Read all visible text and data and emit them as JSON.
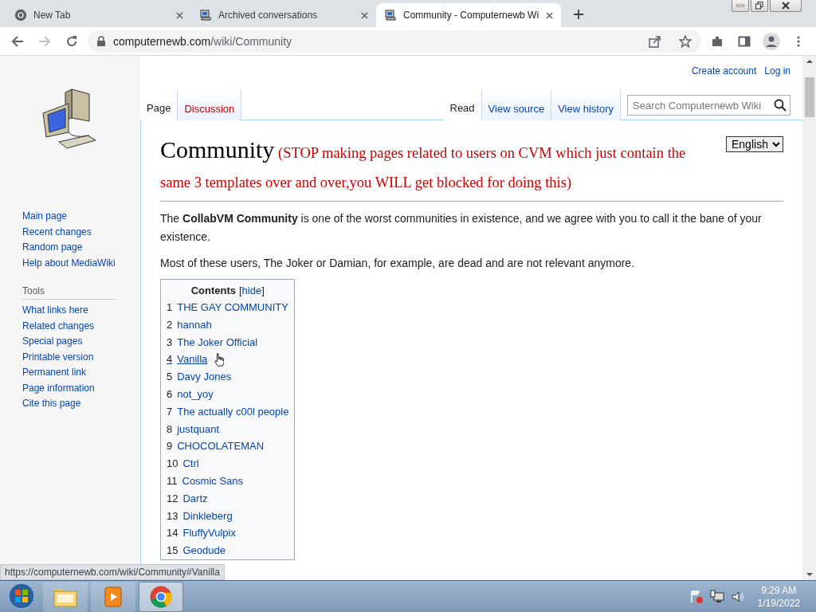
{
  "browser_tabs": [
    {
      "title": "New Tab",
      "selected": false
    },
    {
      "title": "Archived conversations",
      "selected": false
    },
    {
      "title": "Community - Computernewb Wi",
      "selected": true
    }
  ],
  "address_bar": {
    "host": "computernewb.com",
    "path": "/wiki/Community"
  },
  "personal_links": [
    "Create account",
    "Log in"
  ],
  "namespace_tabs": [
    {
      "label": "Page",
      "selected": true,
      "redlink": false
    },
    {
      "label": "Discussion",
      "selected": false,
      "redlink": true
    }
  ],
  "view_tabs": [
    {
      "label": "Read",
      "selected": true
    },
    {
      "label": "View source",
      "selected": false
    },
    {
      "label": "View history",
      "selected": false
    }
  ],
  "search": {
    "placeholder": "Search Computernewb Wiki"
  },
  "sidebar": {
    "navigation": [
      "Main page",
      "Recent changes",
      "Random page",
      "Help about MediaWiki"
    ],
    "tools_heading": "Tools",
    "tools": [
      "What links here",
      "Related changes",
      "Special pages",
      "Printable version",
      "Permanent link",
      "Page information",
      "Cite this page"
    ]
  },
  "article": {
    "title": "Community",
    "title_note": "(STOP making pages related to users on CVM which just contain the same 3 templates over and over,you WILL get blocked for doing this)",
    "language": "English",
    "paragraphs": [
      "The **CollabVM Community** is one of the worst communities in existence, and we agree with you to call it the bane of your existence.",
      "Most of these users, The Joker or Damian, for example, are dead and are not relevant anymore."
    ],
    "toc": {
      "title": "Contents",
      "toggle": "[hide]",
      "items": [
        {
          "number": "1",
          "label": "THE GAY COMMUNITY",
          "hovered": false
        },
        {
          "number": "2",
          "label": "hannah",
          "hovered": false
        },
        {
          "number": "3",
          "label": "The Joker Official",
          "hovered": false
        },
        {
          "number": "4",
          "label": "Vanilla",
          "hovered": true
        },
        {
          "number": "5",
          "label": "Davy Jones",
          "hovered": false
        },
        {
          "number": "6",
          "label": "not_yoy",
          "hovered": false
        },
        {
          "number": "7",
          "label": "The actually c00l people",
          "hovered": false
        },
        {
          "number": "8",
          "label": "justquant",
          "hovered": false
        },
        {
          "number": "9",
          "label": "CHOCOLATEMAN",
          "hovered": false
        },
        {
          "number": "10",
          "label": "Ctrl",
          "hovered": false
        },
        {
          "number": "11",
          "label": "Cosmic Sans",
          "hovered": false
        },
        {
          "number": "12",
          "label": "Dartz",
          "hovered": false
        },
        {
          "number": "13",
          "label": "Dinkleberg",
          "hovered": false
        },
        {
          "number": "14",
          "label": "FluffyVulpix",
          "hovered": false
        },
        {
          "number": "15",
          "label": "Geodude",
          "hovered": false
        }
      ]
    }
  },
  "status_url": "https://computernewb.com/wiki/Community#Vanilla",
  "taskbar": {
    "apps": [
      {
        "active": false
      },
      {
        "active": false
      },
      {
        "active": true
      }
    ],
    "time": "9:29 AM",
    "date": "1/19/2022"
  }
}
